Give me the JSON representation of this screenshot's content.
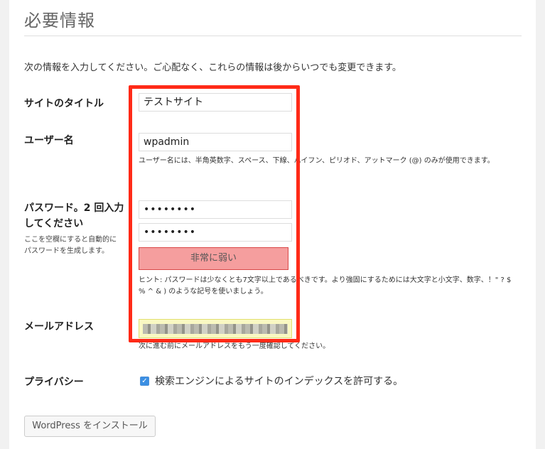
{
  "heading": "必要情報",
  "intro": "次の情報を入力してください。ご心配なく、これらの情報は後からいつでも変更できます。",
  "site_title": {
    "label": "サイトのタイトル",
    "value": "テストサイト"
  },
  "username": {
    "label": "ユーザー名",
    "value": "wpadmin",
    "note": "ユーザー名には、半角英数字、スペース、下線、ハイフン、ピリオド、アットマーク (@) のみが使用できます。"
  },
  "password": {
    "label": "パスワード。2 回入力してください",
    "helper": "ここを空欄にすると自動的にパスワードを生成します。",
    "value1": "••••••••",
    "value2": "••••••••",
    "strength": "非常に弱い",
    "hint": "ヒント: パスワードは少なくとも7文字以上であるべきです。より強固にするためには大文字と小文字、数字、！\" ? $ % ^ & ) のような記号を使いましょう。"
  },
  "email": {
    "label": "メールアドレス",
    "value": "",
    "note": "次に進む前にメールアドレスをもう一度確認してください。"
  },
  "privacy": {
    "label": "プライバシー",
    "checkbox_text": "検索エンジンによるサイトのインデックスを許可する。",
    "checked": true
  },
  "install_button": "WordPress をインストール",
  "colors": {
    "highlight": "#ff2a17",
    "strength_bg": "#f59e9e",
    "email_bg": "#f9f8c2",
    "checkbox": "#3b8fe3"
  }
}
